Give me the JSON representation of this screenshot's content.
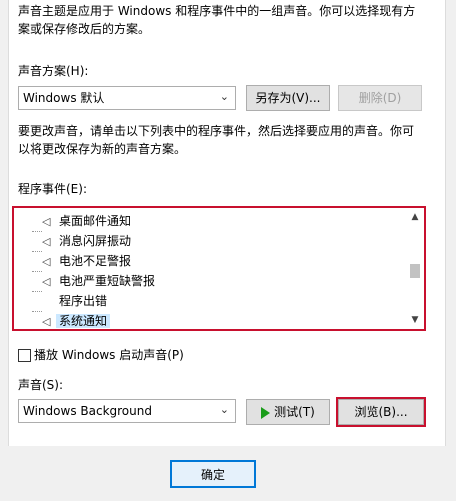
{
  "intro": {
    "line1": "声音主题是应用于 Windows 和程序事件中的一组声音。你可以选择现有方",
    "line2": "案或保存修改后的方案。"
  },
  "scheme": {
    "label": "声音方案(H):",
    "selected": "Windows 默认",
    "save_as_label": "另存为(V)...",
    "delete_label": "删除(D)"
  },
  "help": {
    "line1": "要更改声音，请单击以下列表中的程序事件，然后选择要应用的声音。你可",
    "line2": "以将更改保存为新的声音方案。"
  },
  "events": {
    "label": "程序事件(E):",
    "items": [
      {
        "label": "桌面邮件通知",
        "has_sound": true,
        "selected": false
      },
      {
        "label": "消息闪屏振动",
        "has_sound": true,
        "selected": false
      },
      {
        "label": "电池不足警报",
        "has_sound": true,
        "selected": false
      },
      {
        "label": "电池严重短缺警报",
        "has_sound": true,
        "selected": false
      },
      {
        "label": "程序出错",
        "has_sound": false,
        "selected": false
      },
      {
        "label": "系统通知",
        "has_sound": true,
        "selected": true
      }
    ]
  },
  "startup": {
    "label": "播放 Windows 启动声音(P)",
    "checked": false
  },
  "sound": {
    "label": "声音(S):",
    "selected": "Windows Background",
    "test_label": "测试(T)",
    "browse_label": "浏览(B)..."
  },
  "footer": {
    "ok_label": "确定"
  },
  "colors": {
    "highlight_border": "#c8102e",
    "selection": "#cce8ff",
    "play_icon": "#1a9c1a"
  }
}
